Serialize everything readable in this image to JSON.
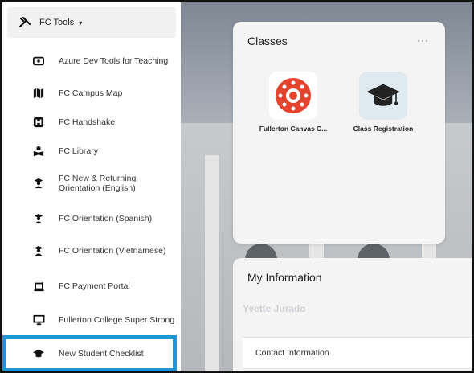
{
  "sidebar": {
    "header": {
      "label": "FC Tools",
      "icon": "tools-icon",
      "caret": "▾"
    },
    "items": [
      {
        "label": "Azure Dev Tools for Teaching",
        "icon": "id-badge-icon"
      },
      {
        "label": "FC Campus Map",
        "icon": "map-icon"
      },
      {
        "label": "FC Handshake",
        "icon": "handshake-icon"
      },
      {
        "label": "FC Library",
        "icon": "book-reader-icon"
      },
      {
        "label": "FC New & Returning Orientation (English)",
        "icon": "graduate-icon"
      },
      {
        "label": "FC Orientation (Spanish)",
        "icon": "graduate-icon"
      },
      {
        "label": "FC Orientation (Vietnamese)",
        "icon": "graduate-icon"
      },
      {
        "label": "FC Payment Portal",
        "icon": "payment-icon"
      },
      {
        "label": "Fullerton College Super Strong",
        "icon": "desktop-icon"
      },
      {
        "label": "New Student Checklist",
        "icon": "graduation-cap-icon"
      }
    ],
    "highlight_color": "#1e96d2"
  },
  "classes_card": {
    "title": "Classes",
    "more": "···",
    "apps": [
      {
        "name": "Fullerton Canvas C...",
        "icon": "canvas-logo-icon",
        "color": "#e4432d"
      },
      {
        "name": "Class Registration",
        "icon": "graduation-cap-icon",
        "color": "#dfe9f0"
      }
    ]
  },
  "info_card": {
    "title": "My Information",
    "user_name": "Yvette Jurado",
    "section": "Contact Information"
  }
}
